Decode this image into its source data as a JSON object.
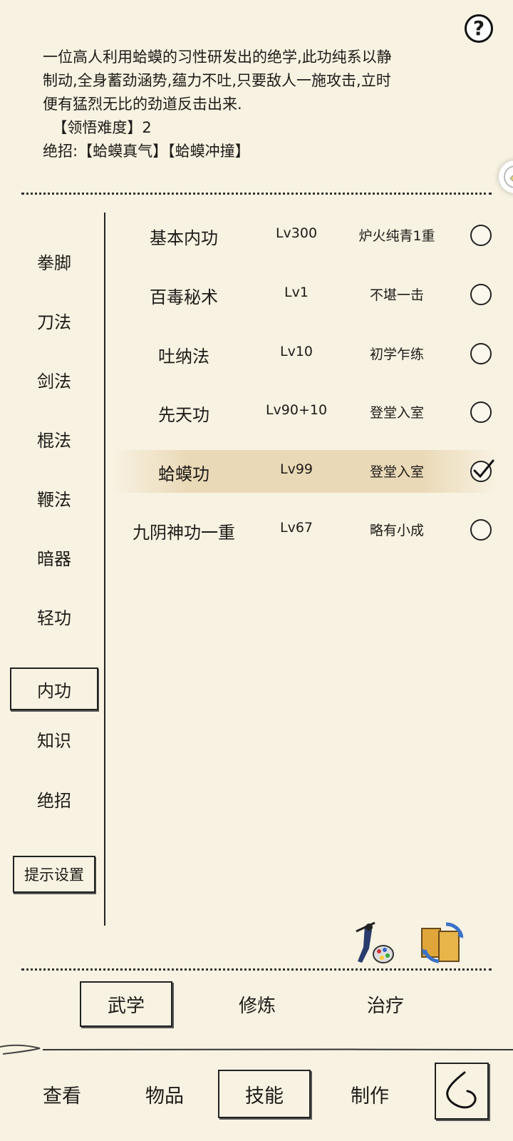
{
  "help": {
    "icon": "question-icon",
    "label": "?"
  },
  "description": {
    "lines": [
      "一位高人利用蛤蟆的习性研发出的绝学,此功纯系以静",
      "制动,全身蓄劲涵势,蕴力不吐,只要敌人一施攻击,立时",
      "便有猛烈无比的劲道反击出来.",
      "  【领悟难度】2",
      "绝招:【蛤蟆真气】【蛤蟆冲撞】"
    ]
  },
  "categories": {
    "items": [
      "拳脚",
      "刀法",
      "剑法",
      "棍法",
      "鞭法",
      "暗器",
      "轻功",
      "内功",
      "知识",
      "绝招"
    ],
    "active": "内功",
    "settings_label": "提示设置"
  },
  "skills": [
    {
      "name": "基本内功",
      "level": "Lv300",
      "status": "炉火纯青1重",
      "checked": false
    },
    {
      "name": "百毒秘术",
      "level": "Lv1",
      "status": "不堪一击",
      "checked": false
    },
    {
      "name": "吐纳法",
      "level": "Lv10",
      "status": "初学乍练",
      "checked": false
    },
    {
      "name": "先天功",
      "level": "Lv90+10",
      "status": "登堂入室",
      "checked": false
    },
    {
      "name": "蛤蟆功",
      "level": "Lv99",
      "status": "登堂入室",
      "checked": true
    },
    {
      "name": "九阴神功一重",
      "level": "Lv67",
      "status": "略有小成",
      "checked": false
    }
  ],
  "action_icons": [
    "paint-palette-icon",
    "swap-books-icon"
  ],
  "tabs": {
    "wuxue": "武学",
    "xiulian": "修炼",
    "zhiliao": "治疗",
    "active": "武学"
  },
  "nav": {
    "view": "查看",
    "items": "物品",
    "skills": "技能",
    "craft": "制作",
    "active": "技能",
    "back_icon": "back-arrow-icon"
  }
}
